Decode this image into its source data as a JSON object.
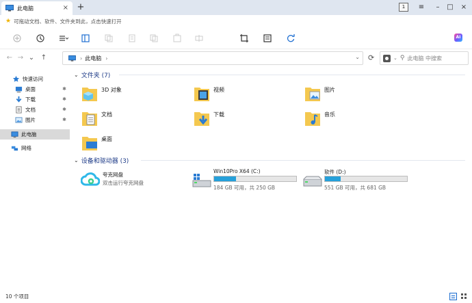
{
  "window": {
    "tab_title": "此电脑",
    "tab_close": "×",
    "new_tab": "+",
    "page_badge": "1",
    "controls": {
      "menu": "≡",
      "minimize": "–",
      "maximize": "□",
      "close": "×"
    }
  },
  "notice": {
    "text": "可拖动文档、软件、文件夹到此，点击快速打开"
  },
  "toolbar": {
    "icons": [
      "new-icon",
      "history-icon",
      "view-menu-icon",
      "pane-icon",
      "copy-icon",
      "paste-icon",
      "copy-path-icon",
      "move-icon",
      "rename-icon",
      "crop-icon",
      "archive-icon",
      "sync-icon"
    ],
    "ai_label": "AI"
  },
  "address": {
    "back": "←",
    "forward": "→",
    "recent": "⌄",
    "up": "↑",
    "crumb": "此电脑",
    "sep": "›",
    "dropdown": "⌄",
    "refresh": "⟳",
    "search_placeholder": "此电脑 中搜索",
    "search_chevron": "⌄",
    "search_mag": "⚲"
  },
  "sidebar": {
    "pin": "✱",
    "items": [
      {
        "label": "快速访问",
        "icon": "star-icon"
      },
      {
        "label": "桌面",
        "icon": "desktop-icon",
        "pinned": true
      },
      {
        "label": "下载",
        "icon": "download-icon",
        "pinned": true
      },
      {
        "label": "文档",
        "icon": "document-icon",
        "pinned": true
      },
      {
        "label": "图片",
        "icon": "picture-icon",
        "pinned": true
      },
      {
        "label": "此电脑",
        "icon": "computer-icon",
        "selected": true
      },
      {
        "label": "网络",
        "icon": "network-icon"
      }
    ]
  },
  "main": {
    "folders_header": "文件夹 (7)",
    "header_chevron": "⌄",
    "folders": [
      {
        "name": "3D 对象",
        "icon": "3d-objects-folder-icon"
      },
      {
        "name": "视频",
        "icon": "video-folder-icon"
      },
      {
        "name": "图片",
        "icon": "pictures-folder-icon"
      },
      {
        "name": "文档",
        "icon": "documents-folder-icon"
      },
      {
        "name": "下载",
        "icon": "downloads-folder-icon"
      },
      {
        "name": "音乐",
        "icon": "music-folder-icon"
      },
      {
        "name": "桌面",
        "icon": "desktop-folder-icon"
      }
    ],
    "devices_header": "设备和驱动器 (3)",
    "cloud": {
      "name": "夸克网盘",
      "sub": "双击运行夸克网盘",
      "icon": "quark-cloud-icon"
    },
    "drives": [
      {
        "name": "Win10Pro X64 (C:)",
        "size_text": "184 GB 可用，共 250 GB",
        "used_fraction": 0.264,
        "icon": "windows-drive-icon"
      },
      {
        "name": "软件 (D:)",
        "size_text": "551 GB 可用，共 681 GB",
        "used_fraction": 0.191,
        "icon": "hard-drive-icon"
      }
    ]
  },
  "status": {
    "count_text": "10 个项目"
  },
  "colors": {
    "accent": "#1f6fd1",
    "bar_fill": "#26a0da",
    "header_text": "#1f3c88",
    "folder_yellow": "#f4c84f"
  }
}
